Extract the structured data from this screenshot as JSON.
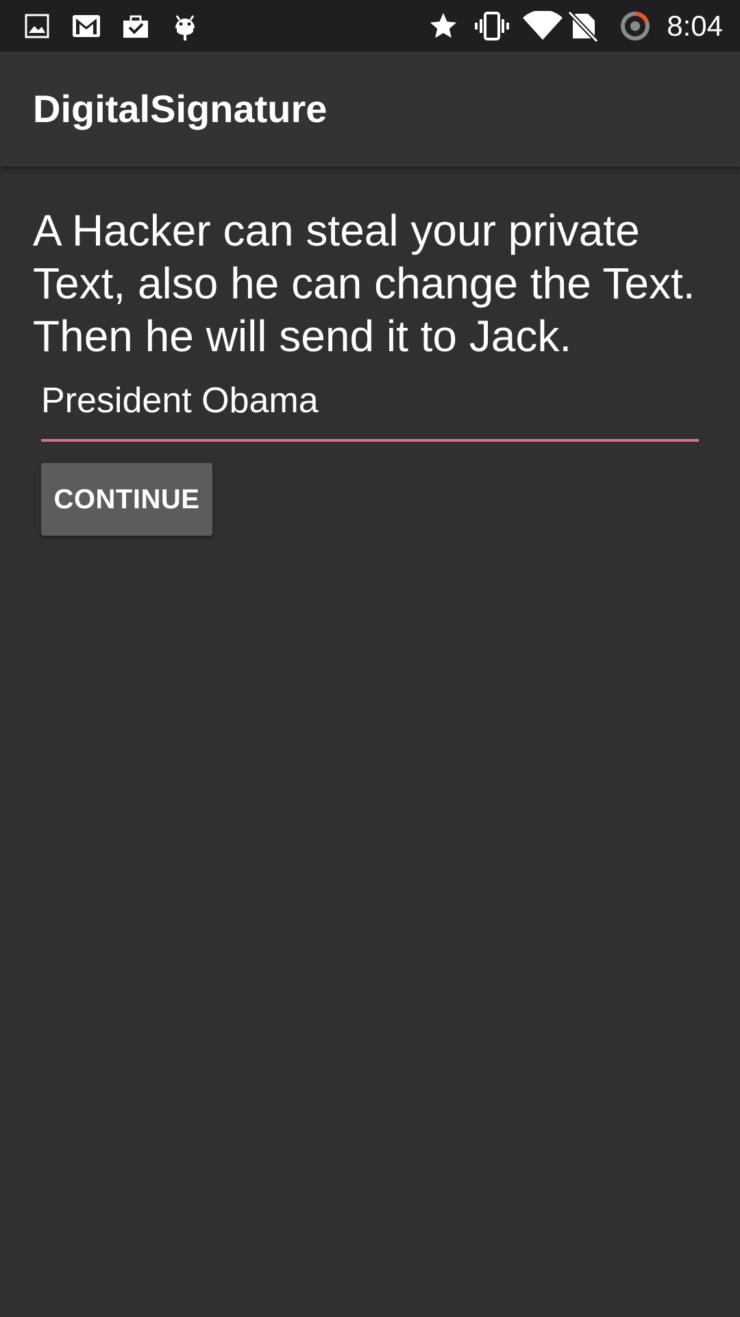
{
  "status_bar": {
    "time": "8:04",
    "left_icons": [
      "image-icon",
      "gmail-icon",
      "briefcase-check-icon",
      "android-icon"
    ],
    "right_icons": [
      "star-icon",
      "vibrate-icon",
      "wifi-icon",
      "no-sim-icon",
      "sync-loading-icon"
    ]
  },
  "app_bar": {
    "title": "DigitalSignature"
  },
  "main": {
    "message": "A Hacker can steal your private Text, also he can change the Text. Then he will send it to Jack.",
    "text_field": {
      "value": "President Obama"
    },
    "continue_label": "CONTINUE"
  },
  "colors": {
    "background": "#303030",
    "status_bar": "#1f1f1f",
    "app_bar": "#333333",
    "field_underline": "#d36f92",
    "button": "#5c5c5c",
    "text": "#ffffff"
  }
}
